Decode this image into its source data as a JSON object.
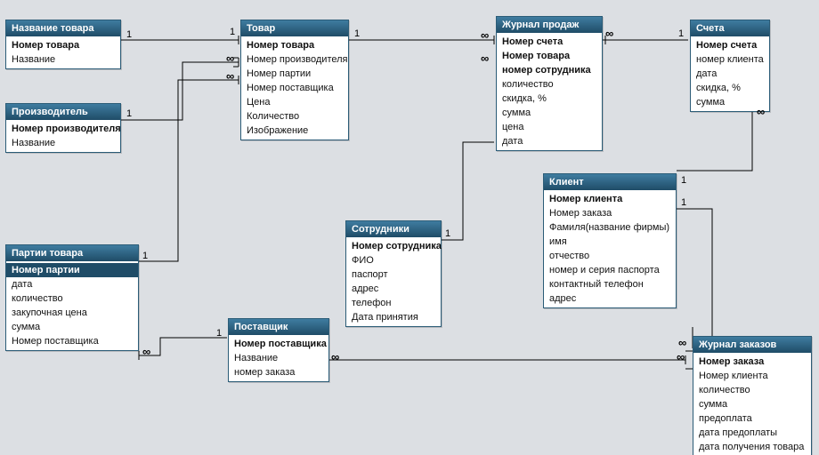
{
  "entities": {
    "product_name": {
      "title": "Название товара",
      "fields": [
        {
          "label": "Номер товара",
          "pk": true
        },
        {
          "label": "Название"
        }
      ]
    },
    "manufacturer": {
      "title": "Производитель",
      "fields": [
        {
          "label": "Номер производителя",
          "pk": true
        },
        {
          "label": "Название"
        }
      ]
    },
    "product": {
      "title": "Товар",
      "fields": [
        {
          "label": "Номер товара",
          "pk": true
        },
        {
          "label": "Номер производителя"
        },
        {
          "label": "Номер партии"
        },
        {
          "label": "Номер поставщика"
        },
        {
          "label": "Цена"
        },
        {
          "label": "Количество"
        },
        {
          "label": "Изображение"
        }
      ]
    },
    "sales_journal": {
      "title": "Журнал продаж",
      "fields": [
        {
          "label": "Номер счета",
          "pk": true
        },
        {
          "label": "Номер товара",
          "pk": true
        },
        {
          "label": "номер сотрудника",
          "pk": true
        },
        {
          "label": "количество"
        },
        {
          "label": "скидка, %"
        },
        {
          "label": "сумма"
        },
        {
          "label": "цена"
        },
        {
          "label": "дата"
        }
      ]
    },
    "accounts": {
      "title": "Счета",
      "fields": [
        {
          "label": "Номер счета",
          "pk": true
        },
        {
          "label": "номер клиента"
        },
        {
          "label": "дата"
        },
        {
          "label": "скидка, %"
        },
        {
          "label": "сумма"
        }
      ]
    },
    "client": {
      "title": "Клиент",
      "fields": [
        {
          "label": "Номер клиента",
          "pk": true
        },
        {
          "label": "Номер заказа"
        },
        {
          "label": "Фамиля(название фирмы)"
        },
        {
          "label": "имя"
        },
        {
          "label": "отчество"
        },
        {
          "label": "номер и серия паспорта"
        },
        {
          "label": "контактный телефон"
        },
        {
          "label": "адрес"
        }
      ]
    },
    "employees": {
      "title": "Сотрудники",
      "fields": [
        {
          "label": "Номер сотрудника",
          "pk": true
        },
        {
          "label": "ФИО"
        },
        {
          "label": "паспорт"
        },
        {
          "label": "адрес"
        },
        {
          "label": "телефон"
        },
        {
          "label": "Дата принятия"
        }
      ]
    },
    "batches": {
      "title": "Партии товара",
      "fields": [
        {
          "label": "Номер партии",
          "pk": true,
          "selected": true
        },
        {
          "label": "дата"
        },
        {
          "label": "количество"
        },
        {
          "label": "закупочная цена"
        },
        {
          "label": "сумма"
        },
        {
          "label": "Номер поставщика"
        }
      ]
    },
    "supplier": {
      "title": "Поставщик",
      "fields": [
        {
          "label": "Номер поставщика",
          "pk": true
        },
        {
          "label": "Название"
        },
        {
          "label": "номер заказа"
        }
      ]
    },
    "order_journal": {
      "title": "Журнал заказов",
      "fields": [
        {
          "label": "Номер заказа",
          "pk": true
        },
        {
          "label": "Номер клиента"
        },
        {
          "label": "количество"
        },
        {
          "label": "сумма"
        },
        {
          "label": "предоплата"
        },
        {
          "label": "дата предоплаты"
        },
        {
          "label": "дата получения товара"
        }
      ]
    }
  },
  "relationships": [
    {
      "from": "product_name",
      "to": "product",
      "card_from": "1",
      "card_to": "1"
    },
    {
      "from": "manufacturer",
      "to": "product",
      "card_from": "1",
      "card_to": "∞"
    },
    {
      "from": "batches",
      "to": "product",
      "card_from": "1",
      "card_to": "∞"
    },
    {
      "from": "supplier",
      "to": "batches",
      "card_from": "1",
      "card_to": "∞"
    },
    {
      "from": "supplier",
      "to": "order_journal",
      "card_from": "∞",
      "card_to": "∞"
    },
    {
      "from": "product",
      "to": "sales_journal",
      "card_from": "1",
      "card_to": "∞"
    },
    {
      "from": "employees",
      "to": "sales_journal",
      "card_from": "1",
      "card_to": "∞"
    },
    {
      "from": "sales_journal",
      "to": "accounts",
      "card_from": "∞",
      "card_to": "1"
    },
    {
      "from": "accounts",
      "to": "client",
      "card_from": "∞",
      "card_to": "1"
    },
    {
      "from": "client",
      "to": "order_journal",
      "card_from": "1",
      "card_to": "∞"
    }
  ]
}
